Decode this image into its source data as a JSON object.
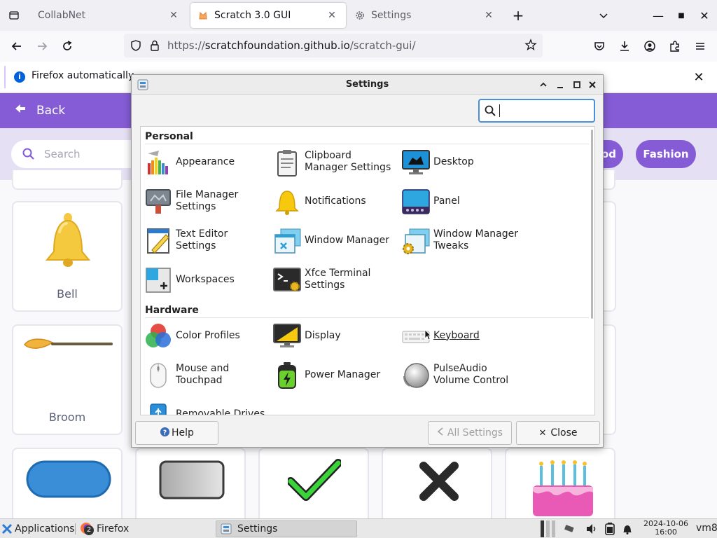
{
  "browser": {
    "tabs": [
      {
        "label": "CollabNet"
      },
      {
        "label": "Scratch 3.0 GUI"
      },
      {
        "label": "Settings"
      }
    ],
    "url": {
      "prefix": "https://",
      "host": "scratchfoundation.github.io",
      "path": "/scratch-gui/"
    },
    "notification": {
      "text": "Firefox automatically"
    }
  },
  "scratch": {
    "back_label": "Back",
    "search_placeholder": "Search",
    "categories": [
      {
        "label": "od"
      },
      {
        "label": "Fashion"
      }
    ],
    "cards": [
      {
        "name": "Bell"
      },
      {
        "name": "Broom"
      }
    ]
  },
  "dialog": {
    "title": "Settings",
    "search_value": "",
    "sections": [
      {
        "label": "Personal",
        "items": [
          {
            "label": "Appearance",
            "icon": "appearance-icon"
          },
          {
            "label": "Clipboard Manager Settings",
            "icon": "clipboard-icon"
          },
          {
            "label": "Desktop",
            "icon": "desktop-icon"
          },
          {
            "label": "File Manager Settings",
            "icon": "file-manager-icon"
          },
          {
            "label": "Notifications",
            "icon": "bell-icon"
          },
          {
            "label": "Panel",
            "icon": "panel-icon"
          },
          {
            "label": "Text Editor Settings",
            "icon": "text-editor-icon"
          },
          {
            "label": "Window Manager",
            "icon": "window-manager-icon"
          },
          {
            "label": "Window Manager Tweaks",
            "icon": "window-tweaks-icon"
          },
          {
            "label": "Workspaces",
            "icon": "workspaces-icon"
          },
          {
            "label": "Xfce Terminal Settings",
            "icon": "terminal-icon"
          }
        ]
      },
      {
        "label": "Hardware",
        "items": [
          {
            "label": "Color Profiles",
            "icon": "color-profiles-icon"
          },
          {
            "label": "Display",
            "icon": "display-icon"
          },
          {
            "label": "Keyboard",
            "icon": "keyboard-icon"
          },
          {
            "label": "Mouse and Touchpad",
            "icon": "mouse-icon"
          },
          {
            "label": "Power Manager",
            "icon": "battery-icon"
          },
          {
            "label": "PulseAudio Volume Control",
            "icon": "speaker-icon"
          },
          {
            "label": "Removable Drives",
            "icon": "usb-icon"
          }
        ]
      }
    ],
    "help_label": "Help",
    "all_settings_label": "All Settings",
    "close_label": "Close"
  },
  "taskbar": {
    "applications_label": "Applications",
    "firefox_label": "Firefox",
    "firefox_count": "2",
    "settings_label": "Settings",
    "date": "2024-10-06",
    "time": "16:00",
    "user": "vm8"
  },
  "colors": {
    "scratch_purple": "#855cd6",
    "firefox_blue": "#0060df",
    "search_focus": "#4a90d9"
  }
}
